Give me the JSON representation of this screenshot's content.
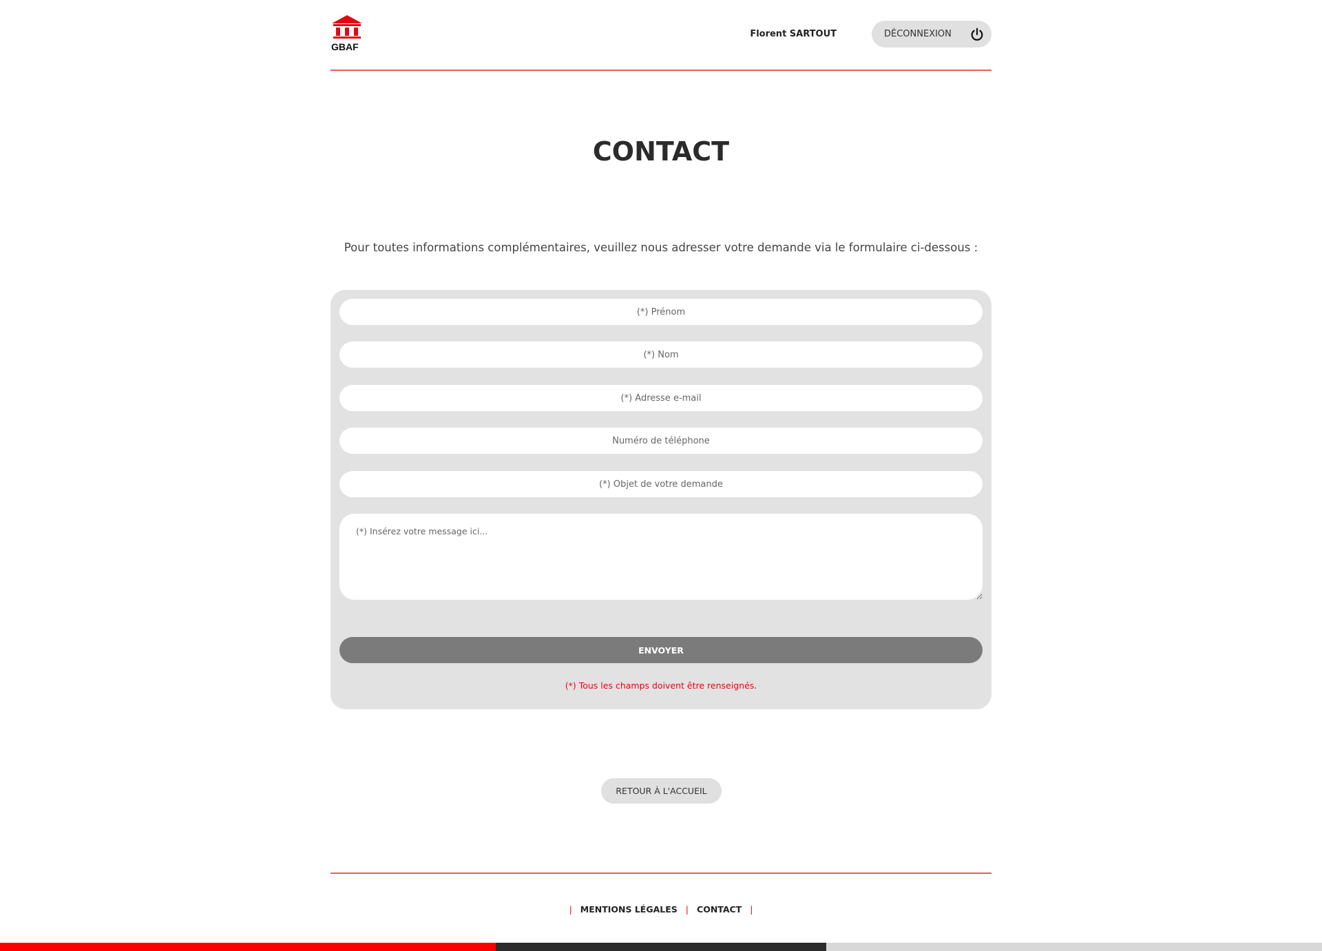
{
  "header": {
    "logo_text": "GBAF",
    "user_name": "Florent SARTOUT",
    "logout_label": "DÉCONNEXION"
  },
  "main": {
    "title": "CONTACT",
    "intro": "Pour toutes informations complémentaires, veuillez nous adresser votre demande via le formulaire ci-dessous :"
  },
  "form": {
    "first_name_placeholder": "(*) Prénom",
    "last_name_placeholder": "(*) Nom",
    "email_placeholder": "(*) Adresse e-mail",
    "phone_placeholder": "Numéro de téléphone",
    "subject_placeholder": "(*) Objet de votre demande",
    "message_placeholder": "(*) Insérez votre message ici...",
    "send_label": "ENVOYER",
    "required_note": "(*) Tous les champs doivent être renseignés."
  },
  "back_home_label": "RETOUR À L'ACCUEIL",
  "footer": {
    "separator": "|",
    "links": [
      "MENTIONS LÉGALES",
      "CONTACT"
    ]
  },
  "colors": {
    "accent": "#e30613",
    "divider": "#f4575a",
    "bar": [
      "#ff0000",
      "#2c2c2c",
      "#d8d8d8"
    ]
  },
  "icons": {
    "logo": "bank-building-icon",
    "logout": "power-icon"
  }
}
